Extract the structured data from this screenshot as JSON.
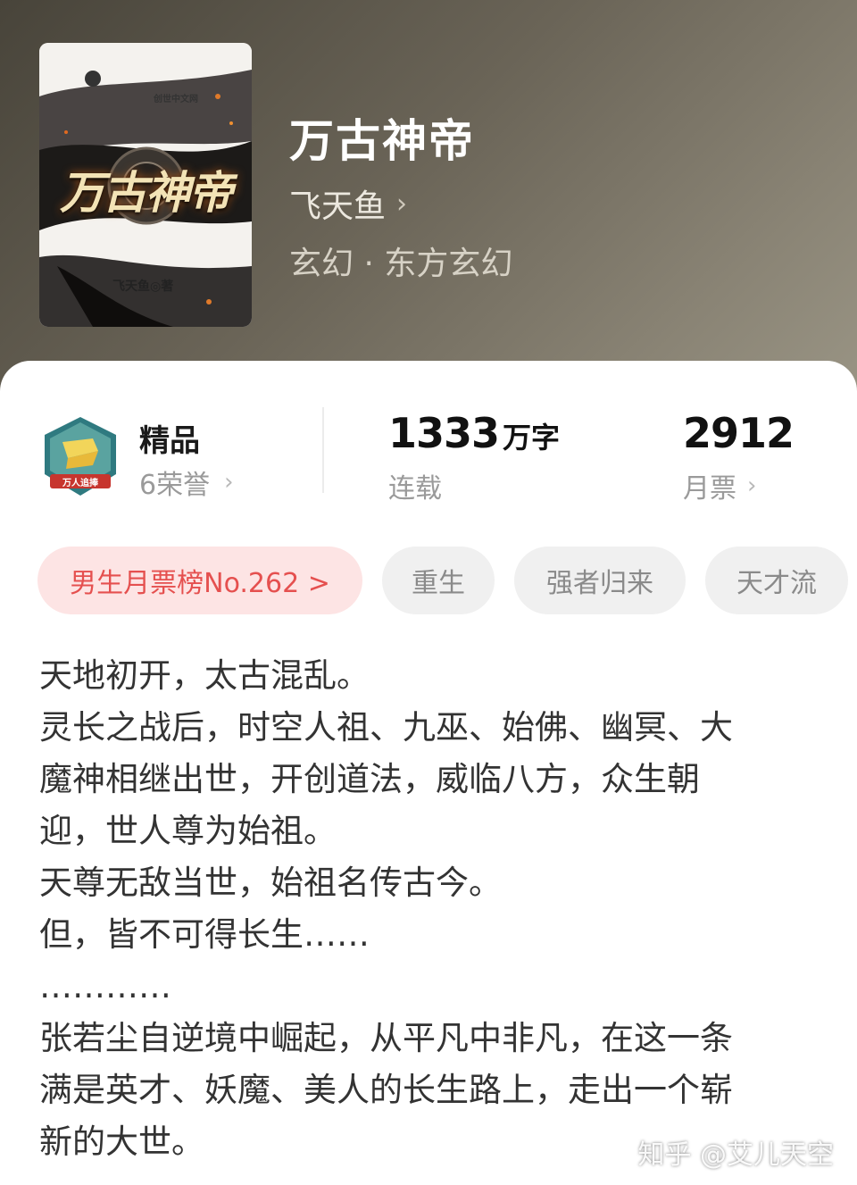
{
  "book": {
    "title": "万古神帝",
    "author": "飞天鱼",
    "genre": "玄幻 · 东方玄幻",
    "cover": {
      "title": "万古神帝",
      "author_line": "飞天鱼◎著",
      "publisher": "创世中文网"
    }
  },
  "stats": {
    "badge_text": "万人追捧",
    "tier_label": "精品",
    "honor_count": "6荣誉",
    "word_count_num": "1333",
    "word_count_unit": "万字",
    "status": "连载",
    "monthly_votes": "2912",
    "votes_label": "月票"
  },
  "tags": {
    "rank": "男生月票榜No.262 >",
    "items": [
      "重生",
      "强者归来",
      "天才流"
    ]
  },
  "synopsis": {
    "lines": [
      "天地初开，太古混乱。",
      "灵长之战后，时空人祖、九巫、始佛、幽冥、大",
      "魔神相继出世，开创道法，威临八方，众生朝",
      "迎，世人尊为始祖。",
      "天尊无敌当世，始祖名传古今。",
      "但，皆不可得长生……",
      "…………",
      "张若尘自逆境中崛起，从平凡中非凡，在这一条",
      "满是英才、妖魔、美人的长生路上，走出一个崭",
      "新的大世。"
    ]
  },
  "watermark": "知乎 @艾儿天空",
  "colors": {
    "rank_bg": "#fde4e4",
    "rank_text": "#e5504f",
    "tag_bg": "#f0f0f0",
    "header_bg": "#6a6457"
  }
}
